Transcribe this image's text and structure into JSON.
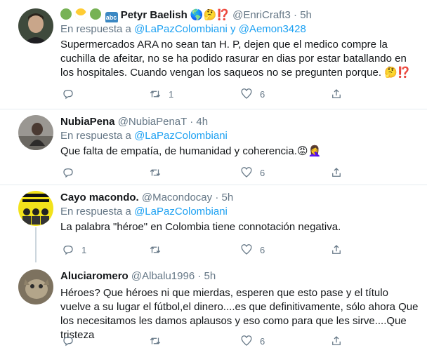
{
  "tweets": [
    {
      "name_prefix_emojis": [
        "avocado-emoji",
        "mask-face-emoji",
        "dragon-face-emoji",
        "abc-emoji"
      ],
      "name": "Petyr Baelish",
      "name_suffix": "🌎🤔⁉️",
      "handle": "@EnriCraft3",
      "time": "5h",
      "replying_prefix": "En respuesta a",
      "replying_to": "@LaPazColombiani y @Aemon3428",
      "text": "Supermercados ARA no sean tan H. P, dejen que el medico compre la cuchilla de afeitar, no se ha podido rasurar en dias por estar batallando en los hospitales. Cuando vengan los saqueos no se pregunten porque. 🤔⁉️",
      "replies": "",
      "retweets": "1",
      "likes": "6"
    },
    {
      "name": "NubiaPena",
      "handle": "@NubiaPenaT",
      "time": "4h",
      "replying_prefix": "En respuesta a",
      "replying_to": "@LaPazColombiani",
      "text": "Que falta de empatía,  de humanidad y coherencia.😡🤦‍♀️",
      "replies": "",
      "retweets": "",
      "likes": "6"
    },
    {
      "name": "Cayo macondo.",
      "handle": "@Macondocay",
      "time": "5h",
      "replying_prefix": "En respuesta a",
      "replying_to": "@LaPazColombiani",
      "text": "La palabra \"héroe\" en Colombia tiene connotación negativa.",
      "replies": "1",
      "retweets": "",
      "likes": "6"
    },
    {
      "name": "Aluciaromero",
      "handle": "@Albalu1996",
      "time": "5h",
      "text": "Héroes? Que héroes ni que mierdas, esperen que esto pase y el título vuelve a su lugar el fútbol,el dinero....es que definitivamente, sólo ahora  Que los necesitamos les damos aplausos y eso como para que les sirve....Que tristeza",
      "replies": "",
      "retweets": "",
      "likes": "6"
    }
  ],
  "colors": {
    "link": "#1da1f2",
    "muted": "#657786",
    "divider": "#e6ecf0"
  }
}
